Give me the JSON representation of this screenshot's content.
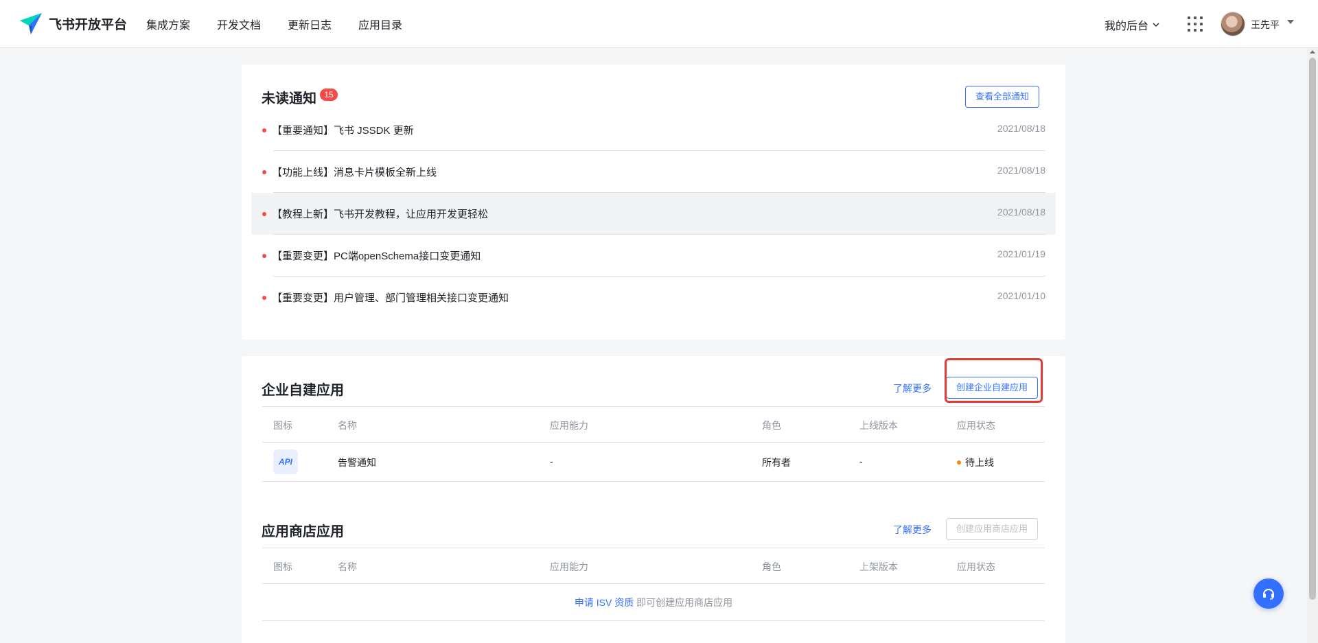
{
  "header": {
    "logo_text": "飞书开放平台",
    "nav": [
      "集成方案",
      "开发文档",
      "更新日志",
      "应用目录"
    ],
    "console_label": "我的后台",
    "username": "王先平"
  },
  "notifications": {
    "title": "未读通知",
    "badge_count": "15",
    "view_all_label": "查看全部通知",
    "items": [
      {
        "text": "【重要通知】飞书 JSSDK 更新",
        "date": "2021/08/18"
      },
      {
        "text": "【功能上线】消息卡片模板全新上线",
        "date": "2021/08/18"
      },
      {
        "text": "【教程上新】飞书开发教程，让应用开发更轻松",
        "date": "2021/08/18"
      },
      {
        "text": "【重要变更】PC端openSchema接口变更通知",
        "date": "2021/01/19"
      },
      {
        "text": "【重要变更】用户管理、部门管理相关接口变更通知",
        "date": "2021/01/10"
      }
    ]
  },
  "enterprise_apps": {
    "title": "企业自建应用",
    "learn_more": "了解更多",
    "create_label": "创建企业自建应用",
    "columns": [
      "图标",
      "名称",
      "应用能力",
      "角色",
      "上线版本",
      "应用状态"
    ],
    "rows": [
      {
        "icon": "API",
        "name": "告警通知",
        "capability": "-",
        "role": "所有者",
        "version": "-",
        "status": "待上线"
      }
    ]
  },
  "store_apps": {
    "title": "应用商店应用",
    "learn_more": "了解更多",
    "create_label": "创建应用商店应用",
    "columns": [
      "图标",
      "名称",
      "应用能力",
      "角色",
      "上架版本",
      "应用状态"
    ],
    "empty_link": "申请 ISV 资质",
    "empty_text": " 即可创建应用商店应用"
  },
  "colors": {
    "accent": "#3370ff",
    "badge": "#f54a45",
    "status_pending": "#ff8800",
    "highlight_box": "#e53935"
  },
  "icons": [
    "feishu-logo-icon",
    "chevron-down-icon",
    "apps-grid-icon",
    "caret-down-icon",
    "headset-help-icon"
  ]
}
